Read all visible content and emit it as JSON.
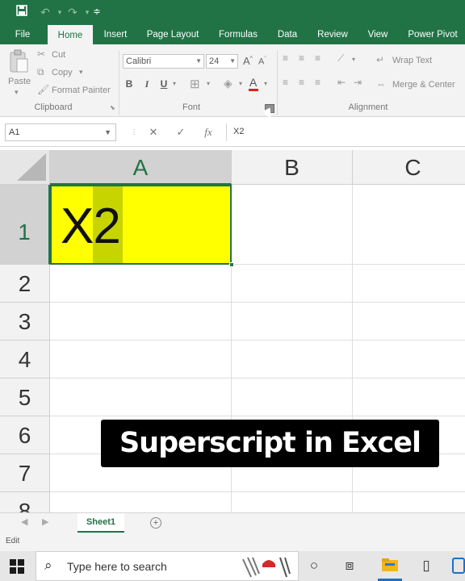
{
  "quick_access": {
    "save_icon": "save-icon",
    "undo_icon": "undo-icon",
    "redo_icon": "redo-icon",
    "customize_icon": "customize-icon"
  },
  "tabs": [
    "File",
    "Home",
    "Insert",
    "Page Layout",
    "Formulas",
    "Data",
    "Review",
    "View",
    "Power Pivot"
  ],
  "active_tab": "Home",
  "clipboard": {
    "paste": "Paste",
    "cut": "Cut",
    "copy": "Copy",
    "format_painter": "Format Painter",
    "label": "Clipboard"
  },
  "font": {
    "name": "Calibri",
    "size": "24",
    "bold": "B",
    "italic": "I",
    "underline": "U",
    "label": "Font"
  },
  "alignment": {
    "wrap_text": "Wrap Text",
    "merge_center": "Merge & Center",
    "label": "Alignment"
  },
  "formula_bar": {
    "name_box": "A1",
    "cancel": "✕",
    "enter": "✓",
    "fx": "fx",
    "value": "X2"
  },
  "sheet": {
    "columns": [
      "A",
      "B",
      "C"
    ],
    "rows": [
      "1",
      "2",
      "3",
      "4",
      "5",
      "6",
      "7",
      "8"
    ],
    "cell_a1": "X2",
    "selected_cell": "A1",
    "fill_color": "#ffff00"
  },
  "overlay_caption": "Superscript in Excel",
  "sheet_tabs": [
    "Sheet1"
  ],
  "status": "Edit",
  "taskbar": {
    "search_placeholder": "Type here to search"
  },
  "colors": {
    "accent": "#217346",
    "cell_fill": "#ffff00"
  }
}
